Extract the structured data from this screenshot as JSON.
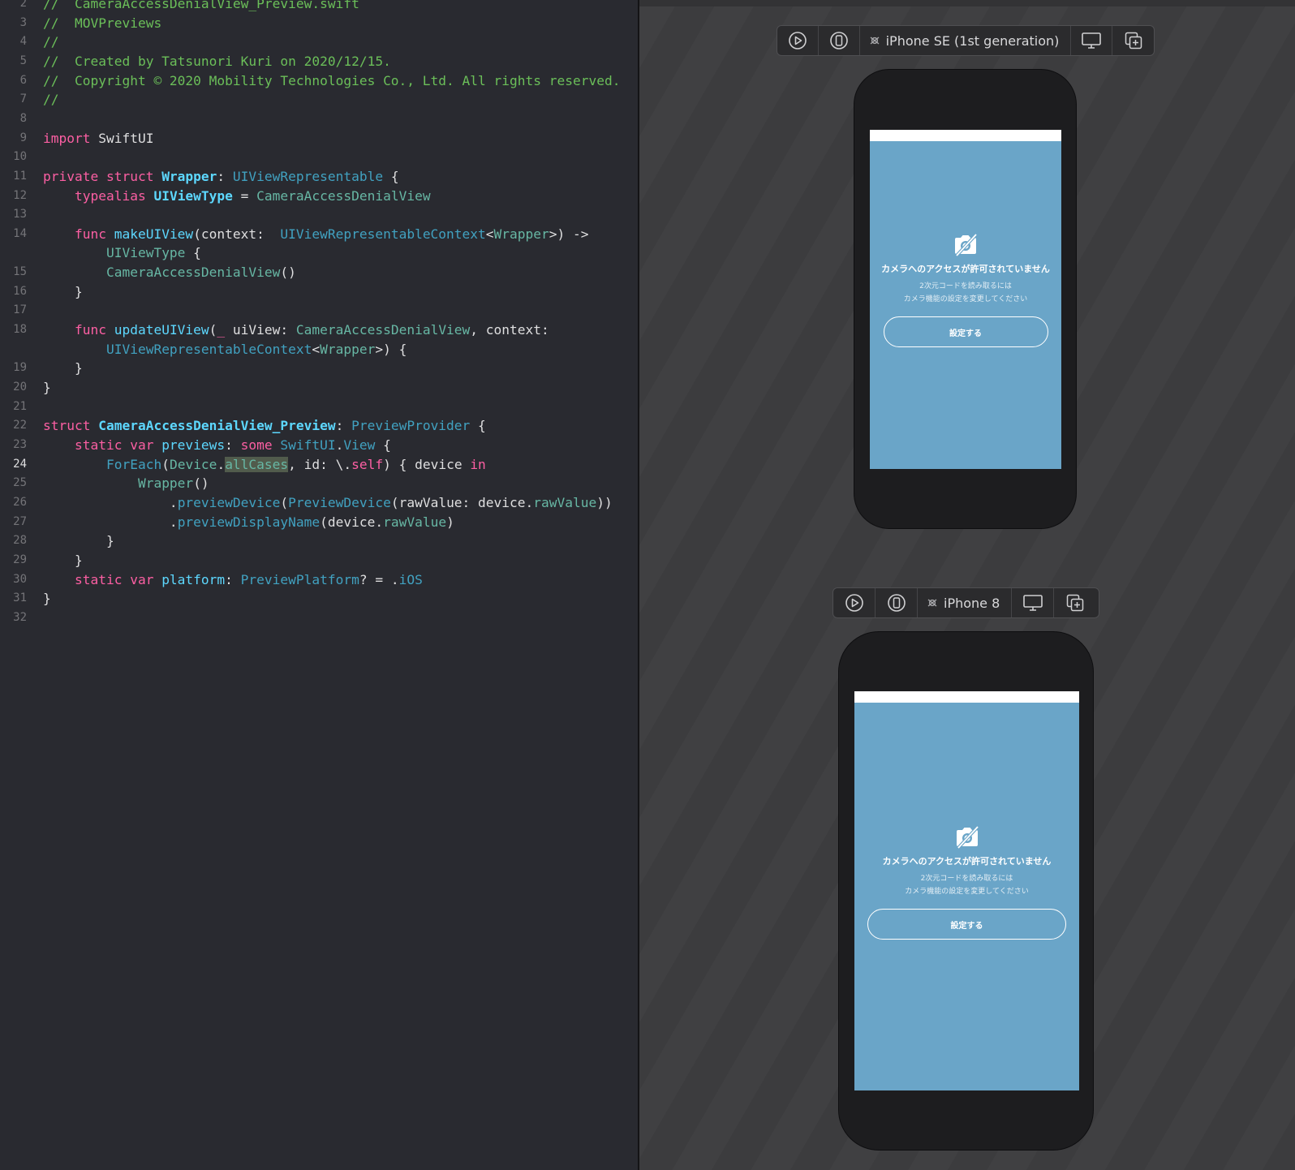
{
  "editor": {
    "current_line": 24,
    "lines": [
      {
        "n": 2,
        "tokens": [
          {
            "c": "cm",
            "t": "//  CameraAccessDenialView_Preview.swift"
          }
        ]
      },
      {
        "n": 3,
        "tokens": [
          {
            "c": "cm",
            "t": "//  MOVPreviews"
          }
        ]
      },
      {
        "n": 4,
        "tokens": [
          {
            "c": "cm",
            "t": "//"
          }
        ]
      },
      {
        "n": 5,
        "tokens": [
          {
            "c": "cm",
            "t": "//  Created by Tatsunori Kuri on 2020/12/15."
          }
        ]
      },
      {
        "n": 6,
        "tokens": [
          {
            "c": "cm",
            "t": "//  Copyright © 2020 Mobility Technologies Co., Ltd. All rights reserved."
          }
        ]
      },
      {
        "n": 7,
        "tokens": [
          {
            "c": "cm",
            "t": "//"
          }
        ]
      },
      {
        "n": 8,
        "tokens": []
      },
      {
        "n": 9,
        "tokens": [
          {
            "c": "kw",
            "t": "import "
          },
          {
            "c": "pl",
            "t": "SwiftUI"
          }
        ]
      },
      {
        "n": 10,
        "tokens": []
      },
      {
        "n": 11,
        "tokens": [
          {
            "c": "kw",
            "t": "private struct "
          },
          {
            "c": "ty",
            "b": true,
            "t": "Wrapper"
          },
          {
            "c": "pl",
            "t": ": "
          },
          {
            "c": "df",
            "t": "UIViewRepresentable"
          },
          {
            "c": "pl",
            "t": " {"
          }
        ]
      },
      {
        "n": 12,
        "tokens": [
          {
            "c": "pl",
            "t": "    "
          },
          {
            "c": "kw",
            "t": "typealias "
          },
          {
            "c": "ty",
            "b": true,
            "t": "UIViewType"
          },
          {
            "c": "pl",
            "t": " = "
          },
          {
            "c": "mt",
            "t": "CameraAccessDenialView"
          }
        ]
      },
      {
        "n": 13,
        "tokens": []
      },
      {
        "n": 14,
        "tokens": [
          {
            "c": "pl",
            "t": "    "
          },
          {
            "c": "kw",
            "t": "func "
          },
          {
            "c": "ty",
            "t": "makeUIView"
          },
          {
            "c": "pl",
            "t": "(context:  "
          },
          {
            "c": "df",
            "t": "UIViewRepresentableContext"
          },
          {
            "c": "pl",
            "t": "<"
          },
          {
            "c": "mt",
            "t": "Wrapper"
          },
          {
            "c": "pl",
            "t": ">) ->"
          }
        ]
      },
      {
        "n": null,
        "tokens": [
          {
            "c": "pl",
            "t": "        "
          },
          {
            "c": "mt",
            "t": "UIViewType"
          },
          {
            "c": "pl",
            "t": " {"
          }
        ]
      },
      {
        "n": 15,
        "tokens": [
          {
            "c": "pl",
            "t": "        "
          },
          {
            "c": "mt",
            "t": "CameraAccessDenialView"
          },
          {
            "c": "pl",
            "t": "()"
          }
        ]
      },
      {
        "n": 16,
        "tokens": [
          {
            "c": "pl",
            "t": "    }"
          }
        ]
      },
      {
        "n": 17,
        "tokens": []
      },
      {
        "n": 18,
        "tokens": [
          {
            "c": "pl",
            "t": "    "
          },
          {
            "c": "kw",
            "t": "func "
          },
          {
            "c": "ty",
            "t": "updateUIView"
          },
          {
            "c": "pl",
            "t": "("
          },
          {
            "c": "kw",
            "t": "_"
          },
          {
            "c": "pl",
            "t": " uiView: "
          },
          {
            "c": "mt",
            "t": "CameraAccessDenialView"
          },
          {
            "c": "pl",
            "t": ", context:"
          }
        ]
      },
      {
        "n": null,
        "tokens": [
          {
            "c": "pl",
            "t": "        "
          },
          {
            "c": "df",
            "t": "UIViewRepresentableContext"
          },
          {
            "c": "pl",
            "t": "<"
          },
          {
            "c": "mt",
            "t": "Wrapper"
          },
          {
            "c": "pl",
            "t": ">) {"
          }
        ]
      },
      {
        "n": 19,
        "tokens": [
          {
            "c": "pl",
            "t": "    }"
          }
        ]
      },
      {
        "n": 20,
        "tokens": [
          {
            "c": "pl",
            "t": "}"
          }
        ]
      },
      {
        "n": 21,
        "tokens": []
      },
      {
        "n": 22,
        "tokens": [
          {
            "c": "kw",
            "t": "struct "
          },
          {
            "c": "ty",
            "b": true,
            "t": "CameraAccessDenialView_Preview"
          },
          {
            "c": "pl",
            "t": ": "
          },
          {
            "c": "df",
            "t": "PreviewProvider"
          },
          {
            "c": "pl",
            "t": " {"
          }
        ]
      },
      {
        "n": 23,
        "tokens": [
          {
            "c": "pl",
            "t": "    "
          },
          {
            "c": "kw",
            "t": "static var "
          },
          {
            "c": "ty",
            "t": "previews"
          },
          {
            "c": "pl",
            "t": ": "
          },
          {
            "c": "kw",
            "t": "some "
          },
          {
            "c": "df",
            "t": "SwiftUI"
          },
          {
            "c": "pl",
            "t": "."
          },
          {
            "c": "df",
            "t": "View"
          },
          {
            "c": "pl",
            "t": " {"
          }
        ]
      },
      {
        "n": 24,
        "tokens": [
          {
            "c": "pl",
            "t": "        "
          },
          {
            "c": "df",
            "t": "ForEach"
          },
          {
            "c": "pl",
            "t": "("
          },
          {
            "c": "mt",
            "t": "Device"
          },
          {
            "c": "pl",
            "t": "."
          },
          {
            "c": "mt",
            "hl": true,
            "t": "allCases"
          },
          {
            "c": "pl",
            "t": ", id: \\."
          },
          {
            "c": "kw",
            "t": "self"
          },
          {
            "c": "pl",
            "t": ") { device "
          },
          {
            "c": "kw",
            "t": "in"
          }
        ]
      },
      {
        "n": 25,
        "tokens": [
          {
            "c": "pl",
            "t": "            "
          },
          {
            "c": "mt",
            "t": "Wrapper"
          },
          {
            "c": "pl",
            "t": "()"
          }
        ]
      },
      {
        "n": 26,
        "tokens": [
          {
            "c": "pl",
            "t": "                ."
          },
          {
            "c": "df",
            "t": "previewDevice"
          },
          {
            "c": "pl",
            "t": "("
          },
          {
            "c": "df",
            "t": "PreviewDevice"
          },
          {
            "c": "pl",
            "t": "(rawValue: device."
          },
          {
            "c": "mt",
            "t": "rawValue"
          },
          {
            "c": "pl",
            "t": "))"
          }
        ]
      },
      {
        "n": 27,
        "tokens": [
          {
            "c": "pl",
            "t": "                ."
          },
          {
            "c": "df",
            "t": "previewDisplayName"
          },
          {
            "c": "pl",
            "t": "(device."
          },
          {
            "c": "mt",
            "t": "rawValue"
          },
          {
            "c": "pl",
            "t": ")"
          }
        ]
      },
      {
        "n": 28,
        "tokens": [
          {
            "c": "pl",
            "t": "        }"
          }
        ]
      },
      {
        "n": 29,
        "tokens": [
          {
            "c": "pl",
            "t": "    }"
          }
        ]
      },
      {
        "n": 30,
        "tokens": [
          {
            "c": "pl",
            "t": "    "
          },
          {
            "c": "kw",
            "t": "static var "
          },
          {
            "c": "ty",
            "t": "platform"
          },
          {
            "c": "pl",
            "t": ": "
          },
          {
            "c": "df",
            "t": "PreviewPlatform"
          },
          {
            "c": "pl",
            "t": "? = ."
          },
          {
            "c": "df",
            "t": "iOS"
          }
        ]
      },
      {
        "n": 31,
        "tokens": [
          {
            "c": "pl",
            "t": "}"
          }
        ]
      },
      {
        "n": 32,
        "tokens": []
      }
    ],
    "colors": {
      "comment": "#6bbf59",
      "keyword": "#fc5fa3",
      "type_decl": "#5dd8ff",
      "type_ref": "#41a1c0",
      "member": "#67b7a4",
      "plain": "#dfdfe0"
    }
  },
  "previews": [
    {
      "device_name": "iPhone SE (1st generation)",
      "icons": [
        "live-preview-icon",
        "preview-on-device-icon",
        "inspect-preview-icon",
        "device-settings-icon",
        "duplicate-preview-icon"
      ],
      "screen": {
        "title": "カメラへのアクセスが許可されていません",
        "description_line1": "2次元コードを読み取るには",
        "description_line2": "カメラ機能の設定を変更してください",
        "button_label": "設定する"
      }
    },
    {
      "device_name": "iPhone 8",
      "icons": [
        "live-preview-icon",
        "preview-on-device-icon",
        "inspect-preview-icon",
        "device-settings-icon",
        "duplicate-preview-icon"
      ],
      "screen": {
        "title": "カメラへのアクセスが許可されていません",
        "description_line1": "2次元コードを読み取るには",
        "description_line2": "カメラ機能の設定を変更してください",
        "button_label": "設定する"
      }
    }
  ],
  "theme": {
    "screen_bg": "#6aa5c8",
    "canvas_bg": "#3c3c3e",
    "editor_bg": "#292a30"
  }
}
